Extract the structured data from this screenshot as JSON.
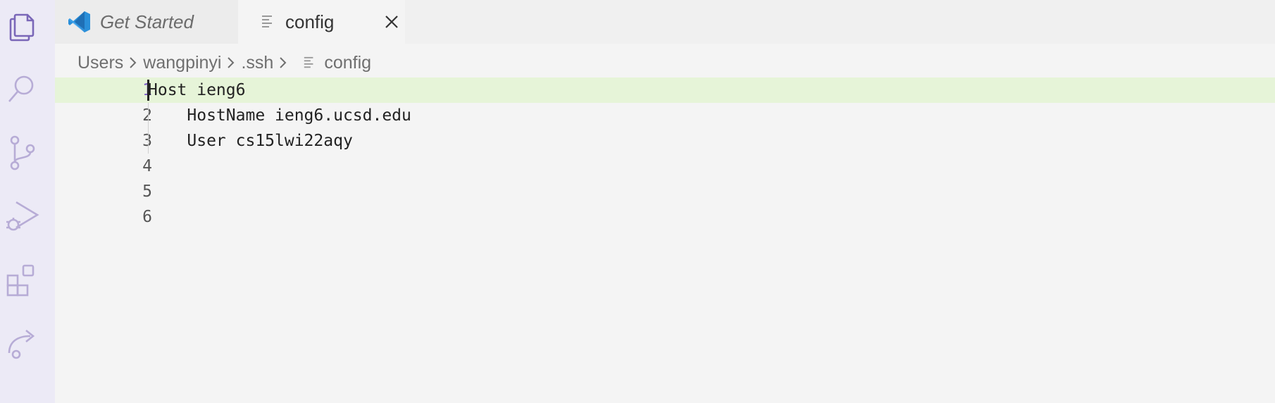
{
  "tabs": [
    {
      "label": "Get Started",
      "icon": "vscode-logo-icon"
    },
    {
      "label": "config",
      "icon": "file-lines-icon"
    }
  ],
  "breadcrumb": {
    "items": [
      "Users",
      "wangpinyi",
      ".ssh",
      "config"
    ]
  },
  "editor": {
    "lines": [
      {
        "number": "1",
        "text": "Host ieng6"
      },
      {
        "number": "2",
        "text": "    HostName ieng6.ucsd.edu"
      },
      {
        "number": "3",
        "text": "    User cs15lwi22aqy"
      },
      {
        "number": "4",
        "text": ""
      },
      {
        "number": "5",
        "text": ""
      },
      {
        "number": "6",
        "text": ""
      }
    ]
  },
  "activity_bar": {
    "icons": [
      "explorer-icon",
      "search-icon",
      "source-control-icon",
      "run-debug-icon",
      "extensions-icon",
      "remote-explorer-icon"
    ]
  },
  "colors": {
    "activity_bar_bg": "#eceaf6",
    "active_line_bg": "#e6f4d8",
    "active_line_number": "#7c5cc8",
    "icon_color": "#b7acd6"
  }
}
